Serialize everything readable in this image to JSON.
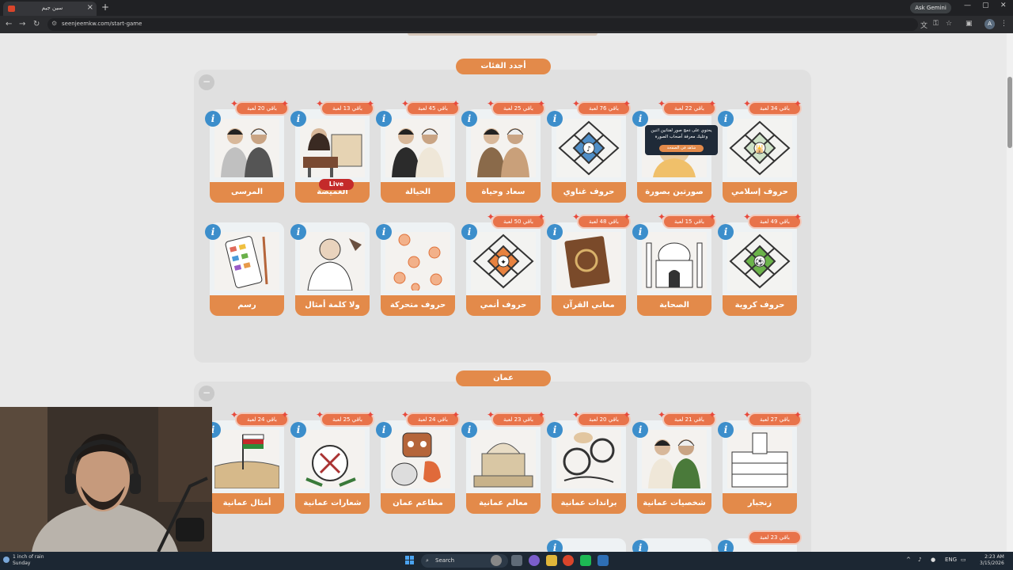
{
  "browser": {
    "tab_title": "سين جيم",
    "new_tab": "+",
    "ask_gemini": "Ask Gemini",
    "url": "seenjeemkw.com/start-game",
    "profile_initial": "A"
  },
  "sections": [
    {
      "title": "أجدد الفئات",
      "collapse": "−",
      "cards": [
        {
          "label": "حروف إسلامي",
          "badge": "باقي 34 لعبة",
          "icon": "letters-grid-mosque-art"
        },
        {
          "label": "صورتين بصورة",
          "badge": "باقي 22 لعبة",
          "icon": "two-faces-art"
        },
        {
          "label": "حروف غناوي",
          "badge": "باقي 76 لعبة",
          "icon": "letters-grid-music-art"
        },
        {
          "label": "سعاد وحياة",
          "badge": "باقي 25 لعبة",
          "icon": "women-portrait-art"
        },
        {
          "label": "الحيالة",
          "badge": "باقي 45 لعبة",
          "icon": "men-portrait-art"
        },
        {
          "label": "الغميضة",
          "badge": "باقي 13 لعبة",
          "icon": "sewing-woman-art",
          "live": "Live"
        },
        {
          "label": "المرسى",
          "badge": "باقي 20 لعبة",
          "icon": "family-art"
        },
        {
          "label": "حروف كروية",
          "badge": "باقي 49 لعبة",
          "icon": "letters-grid-football-art"
        },
        {
          "label": "الصحابة",
          "badge": "باقي 15 لعبة",
          "icon": "mosque-art"
        },
        {
          "label": "معاني القرآن",
          "badge": "باقي 48 لعبة",
          "icon": "quran-book-art"
        },
        {
          "label": "حروف أنمي",
          "badge": "باقي 50 لعبة",
          "icon": "letters-grid-anime-art"
        },
        {
          "label": "حروف متحركة",
          "badge": "",
          "icon": "moving-letters-art"
        },
        {
          "label": "ولا كلمة أمثال",
          "badge": "",
          "icon": "thinking-man-art"
        },
        {
          "label": "رسم",
          "badge": "",
          "icon": "paint-palette-art"
        }
      ],
      "tooltip": {
        "text": "يحتوي على دمج صور لفنانين اثنين وعليك معرفة أصحاب الصورة",
        "button": "شاهد في الصفحة"
      }
    },
    {
      "title": "عمان",
      "collapse": "−",
      "cards": [
        {
          "label": "زنجبار",
          "badge": "باقي 27 لعبة",
          "icon": "zanzibar-building-art"
        },
        {
          "label": "شخصيات عمانية",
          "badge": "باقي 21 لعبة",
          "icon": "omani-people-art"
        },
        {
          "label": "براندات عمانية",
          "badge": "باقي 20 لعبة",
          "icon": "omani-brands-art"
        },
        {
          "label": "معالم عمانية",
          "badge": "باقي 23 لعبة",
          "icon": "omani-landmarks-art"
        },
        {
          "label": "مطاعم عمان",
          "badge": "باقي 24 لعبة",
          "icon": "rooster-restaurant-art"
        },
        {
          "label": "شعارات عمانية",
          "badge": "باقي 25 لعبة",
          "icon": "omani-emblems-art"
        },
        {
          "label": "أمثال عمانية",
          "badge": "باقي 24 لعبة",
          "icon": "omani-fort-flag-art"
        }
      ],
      "partial_badge": "باقي 23 لعبة"
    }
  ],
  "taskbar": {
    "weather": "1 inch of rain",
    "weather_day": "Sunday",
    "search": "Search",
    "lang": "ENG",
    "time": "2:23 AM",
    "date": "3/15/2026"
  },
  "colors": {
    "accent": "#e38a4a",
    "badge": "#e8734a",
    "info": "#3c8ecb",
    "page_bg": "#e9e9e9"
  }
}
